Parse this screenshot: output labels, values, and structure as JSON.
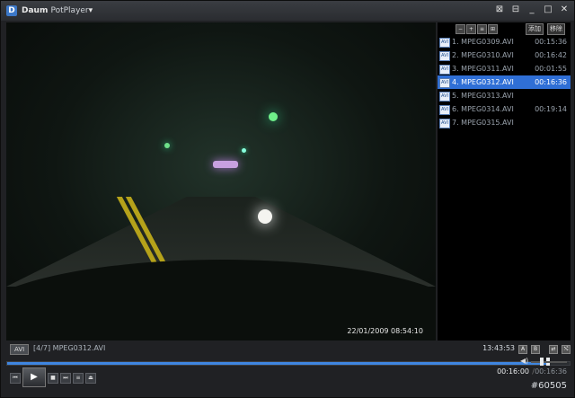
{
  "window": {
    "brand": "Daum",
    "app": "PotPlayer",
    "controls": {
      "menu": "⊠",
      "tray": "⊟",
      "minimize": "_",
      "maximize": "□",
      "close": "✕"
    }
  },
  "video": {
    "overlay_timestamp": "22/01/2009 08:54:10"
  },
  "playlist": {
    "toolbar": {
      "btn1": "−",
      "btn2": "+",
      "btn3": "≡",
      "btn4": "⊞",
      "tag1": "添加",
      "tag2": "移除"
    },
    "items": [
      {
        "name": "1. MPEG0309.AVI",
        "duration": "00:15:36",
        "active": false
      },
      {
        "name": "2. MPEG0310.AVI",
        "duration": "00:16:42",
        "active": false
      },
      {
        "name": "3. MPEG0311.AVI",
        "duration": "00:01:55",
        "active": false
      },
      {
        "name": "4. MPEG0312.AVI",
        "duration": "00:16:36",
        "active": true
      },
      {
        "name": "5. MPEG0313.AVI",
        "duration": "",
        "active": false
      },
      {
        "name": "6. MPEG0314.AVI",
        "duration": "00:19:14",
        "active": false
      },
      {
        "name": "7. MPEG0315.AVI",
        "duration": "",
        "active": false
      }
    ],
    "file_icon_label": "AVI"
  },
  "status": {
    "format": "AVI",
    "file_info": "[4/7] MPEG0312.AVI",
    "clock": "13:43:53"
  },
  "playback": {
    "current_time": "00:16:00",
    "separator": "/",
    "total_time": "00:16:36",
    "progress": 0.963,
    "volume": 0.3
  },
  "controls": {
    "prev": "⏮",
    "play": "▶",
    "stop": "■",
    "next": "⏭",
    "playlist": "≡",
    "eject": "⏏"
  },
  "watermark": "#60505"
}
